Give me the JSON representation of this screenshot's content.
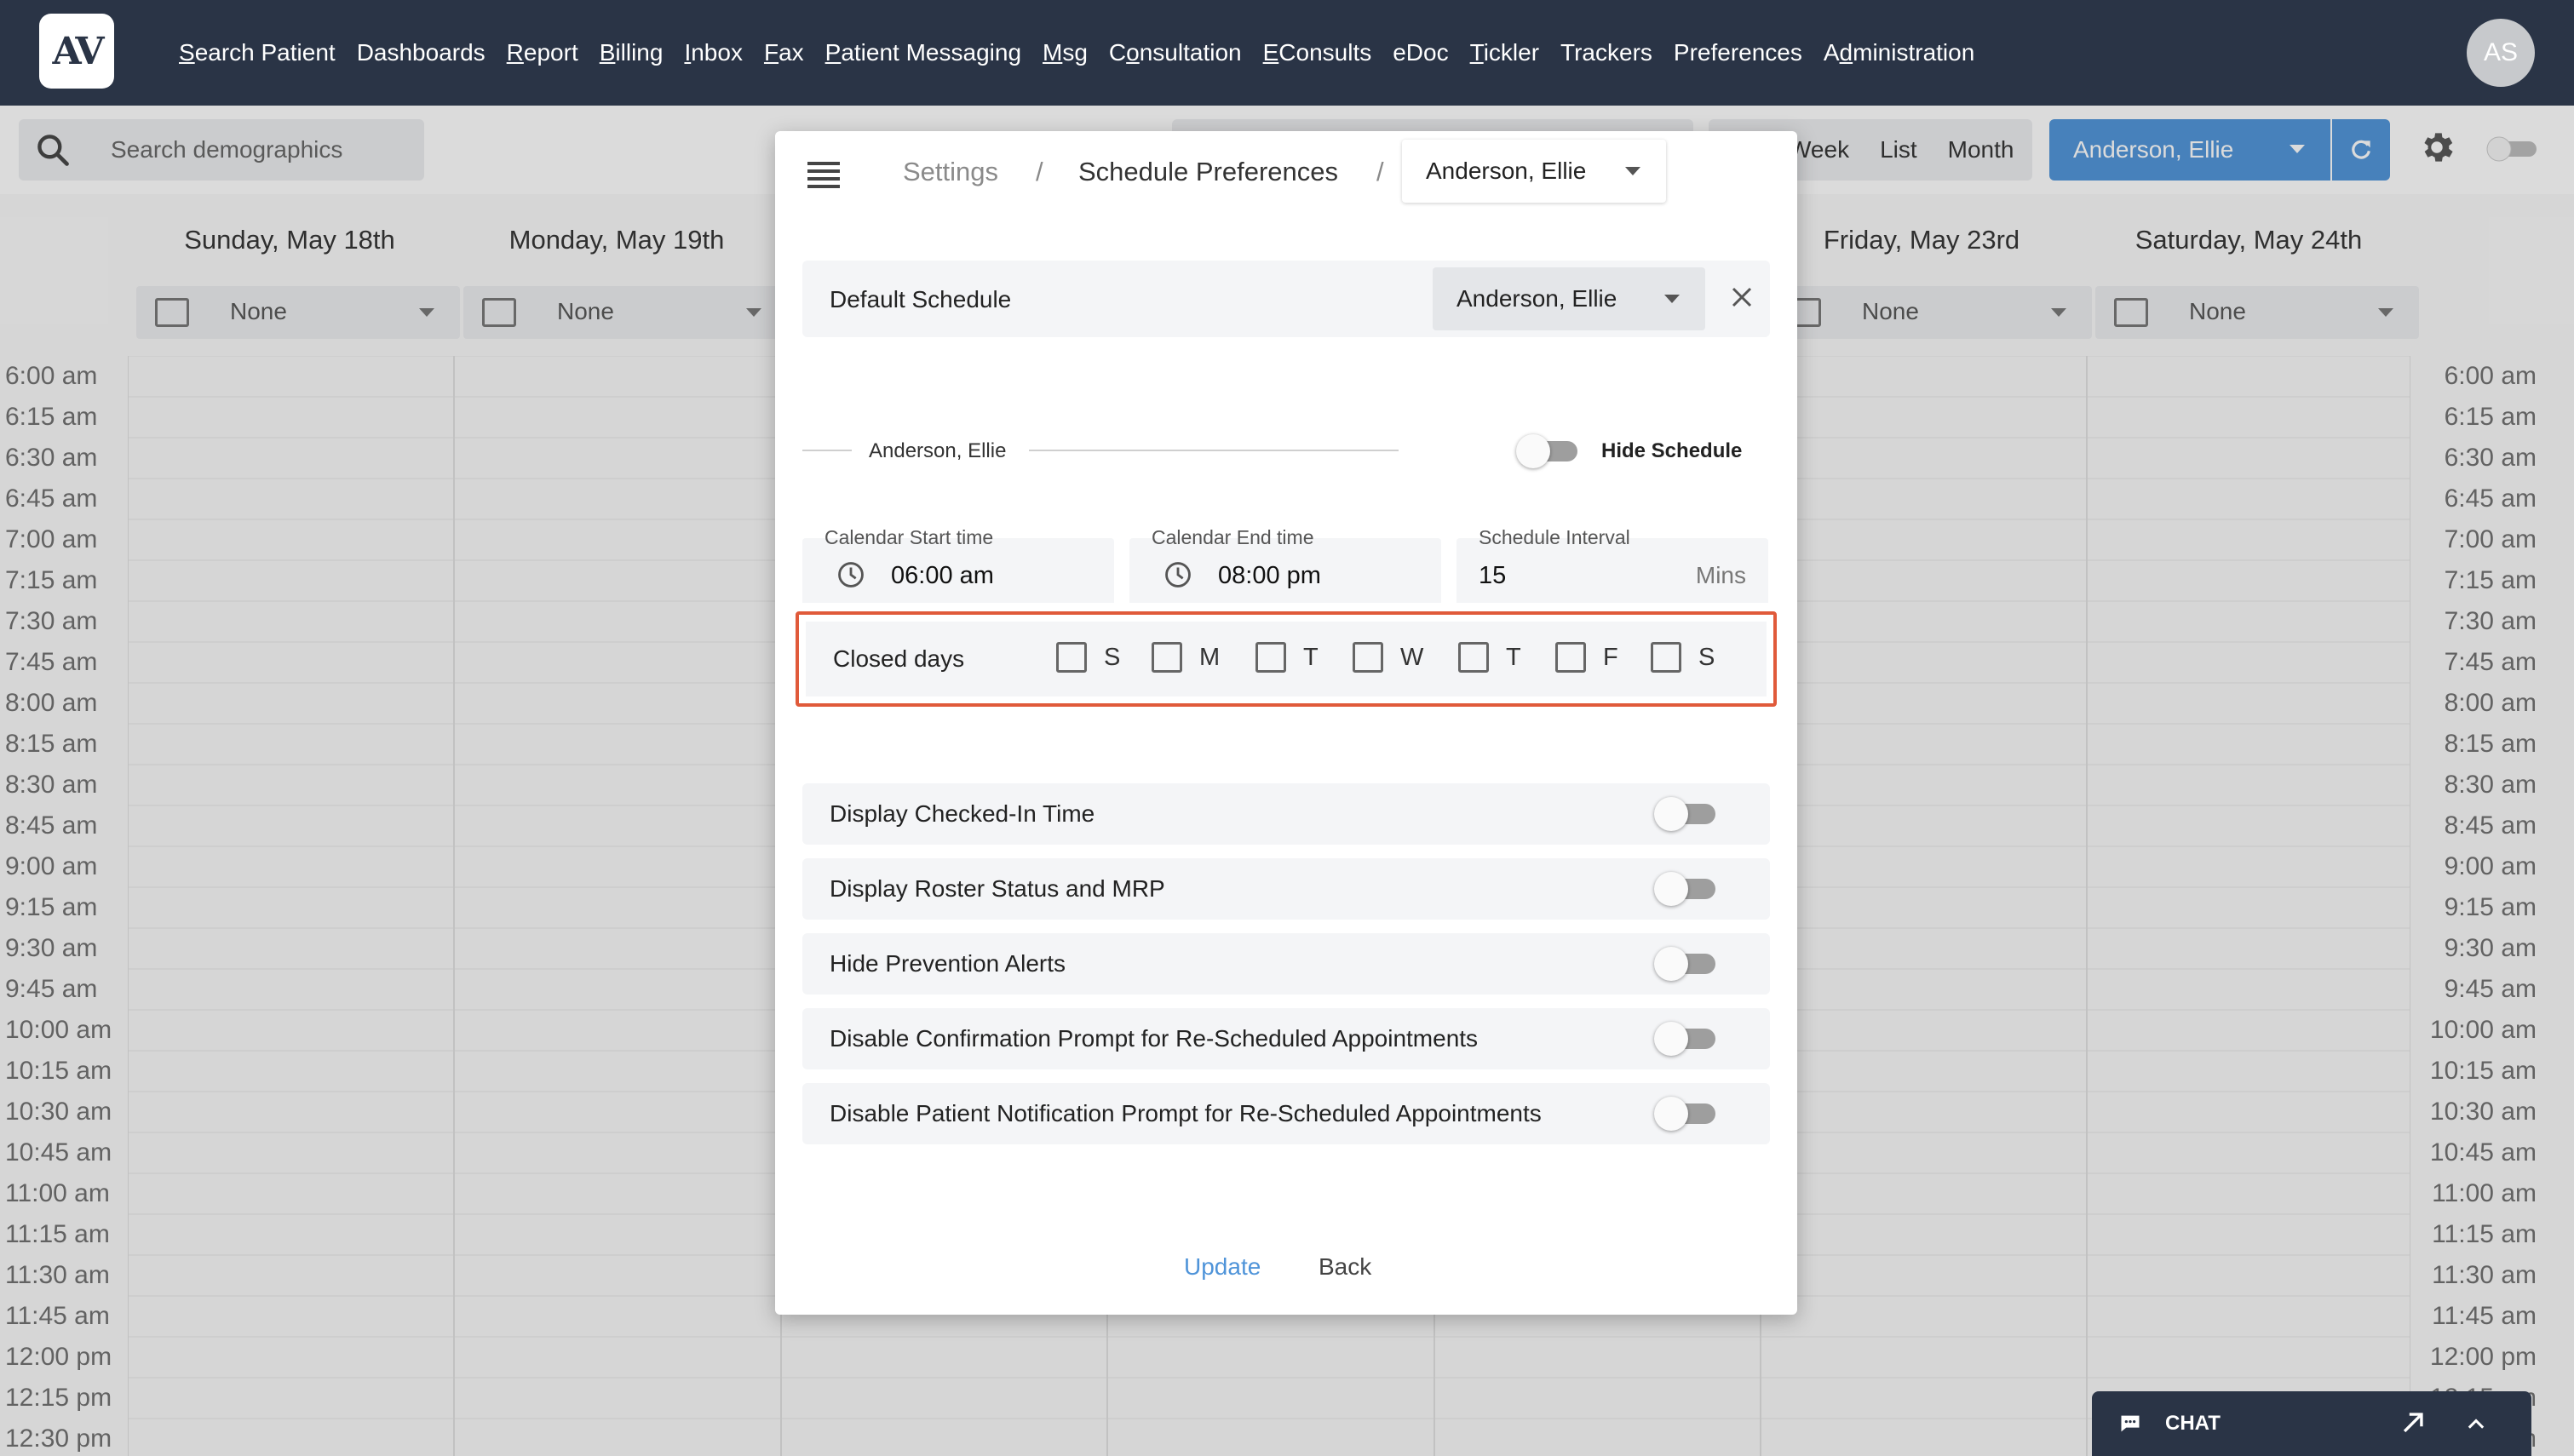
{
  "app": {
    "logo_text": "AV",
    "user_initials": "AS"
  },
  "nav": [
    {
      "first": "S",
      "rest": "earch Patient"
    },
    {
      "first": "",
      "rest": "Dashboards"
    },
    {
      "first": "R",
      "rest": "eport"
    },
    {
      "first": "B",
      "rest": "illing"
    },
    {
      "first": "I",
      "rest": "nbox"
    },
    {
      "first": "F",
      "rest": "ax"
    },
    {
      "first": "P",
      "rest": "atient Messaging"
    },
    {
      "first": "M",
      "rest": "sg"
    },
    {
      "pre": "C",
      "first": "o",
      "rest": "nsultation"
    },
    {
      "first": "E",
      "rest": "Consults"
    },
    {
      "first": "",
      "rest": "eDoc"
    },
    {
      "first": "T",
      "rest": "ickler"
    },
    {
      "first": "",
      "rest": "Trackers"
    },
    {
      "first": "",
      "rest": "Preferences"
    },
    {
      "pre": "A",
      "first": "d",
      "rest": "ministration"
    }
  ],
  "toolbar": {
    "search_placeholder": "Search demographics",
    "views": [
      "Week",
      "List",
      "Month"
    ],
    "provider": "Anderson, Ellie"
  },
  "days": [
    {
      "label": "Sunday, May 18th",
      "select": "None"
    },
    {
      "label": "Monday, May 19th",
      "select": "None"
    },
    {
      "label": "Friday, May 23rd",
      "select": "None"
    },
    {
      "label": "Saturday, May 24th",
      "select": "None"
    }
  ],
  "times": [
    "6:00 am",
    "6:15 am",
    "6:30 am",
    "6:45 am",
    "7:00 am",
    "7:15 am",
    "7:30 am",
    "7:45 am",
    "8:00 am",
    "8:15 am",
    "8:30 am",
    "8:45 am",
    "9:00 am",
    "9:15 am",
    "9:30 am",
    "9:45 am",
    "10:00 am",
    "10:15 am",
    "10:30 am",
    "10:45 am",
    "11:00 am",
    "11:15 am",
    "11:30 am",
    "11:45 am",
    "12:00 pm",
    "12:15 pm",
    "12:30 pm"
  ],
  "modal": {
    "breadcrumb": {
      "settings": "Settings",
      "sep": "/",
      "page": "Schedule Preferences",
      "provider": "Anderson, Ellie"
    },
    "default_schedule": {
      "label": "Default Schedule",
      "value": "Anderson, Ellie"
    },
    "section": {
      "provider": "Anderson, Ellie",
      "hide_label": "Hide Schedule"
    },
    "fields": {
      "start": {
        "label": "Calendar Start time",
        "value": "06:00 am"
      },
      "end": {
        "label": "Calendar End time",
        "value": "08:00 pm"
      },
      "interval": {
        "label": "Schedule Interval",
        "value": "15",
        "unit": "Mins"
      }
    },
    "closed_days": {
      "label": "Closed days",
      "days": [
        "S",
        "M",
        "T",
        "W",
        "T",
        "F",
        "S"
      ]
    },
    "settings": [
      "Display Checked-In Time",
      "Display Roster Status and MRP",
      "Hide Prevention Alerts",
      "Disable Confirmation Prompt for Re-Scheduled Appointments",
      "Disable Patient Notification Prompt for Re-Scheduled Appointments"
    ],
    "buttons": {
      "update": "Update",
      "back": "Back"
    }
  },
  "chat": {
    "label": "CHAT"
  },
  "colors": {
    "nav_bg": "#2a3446",
    "accent": "#4f94d9",
    "highlight": "#e05a3a"
  }
}
